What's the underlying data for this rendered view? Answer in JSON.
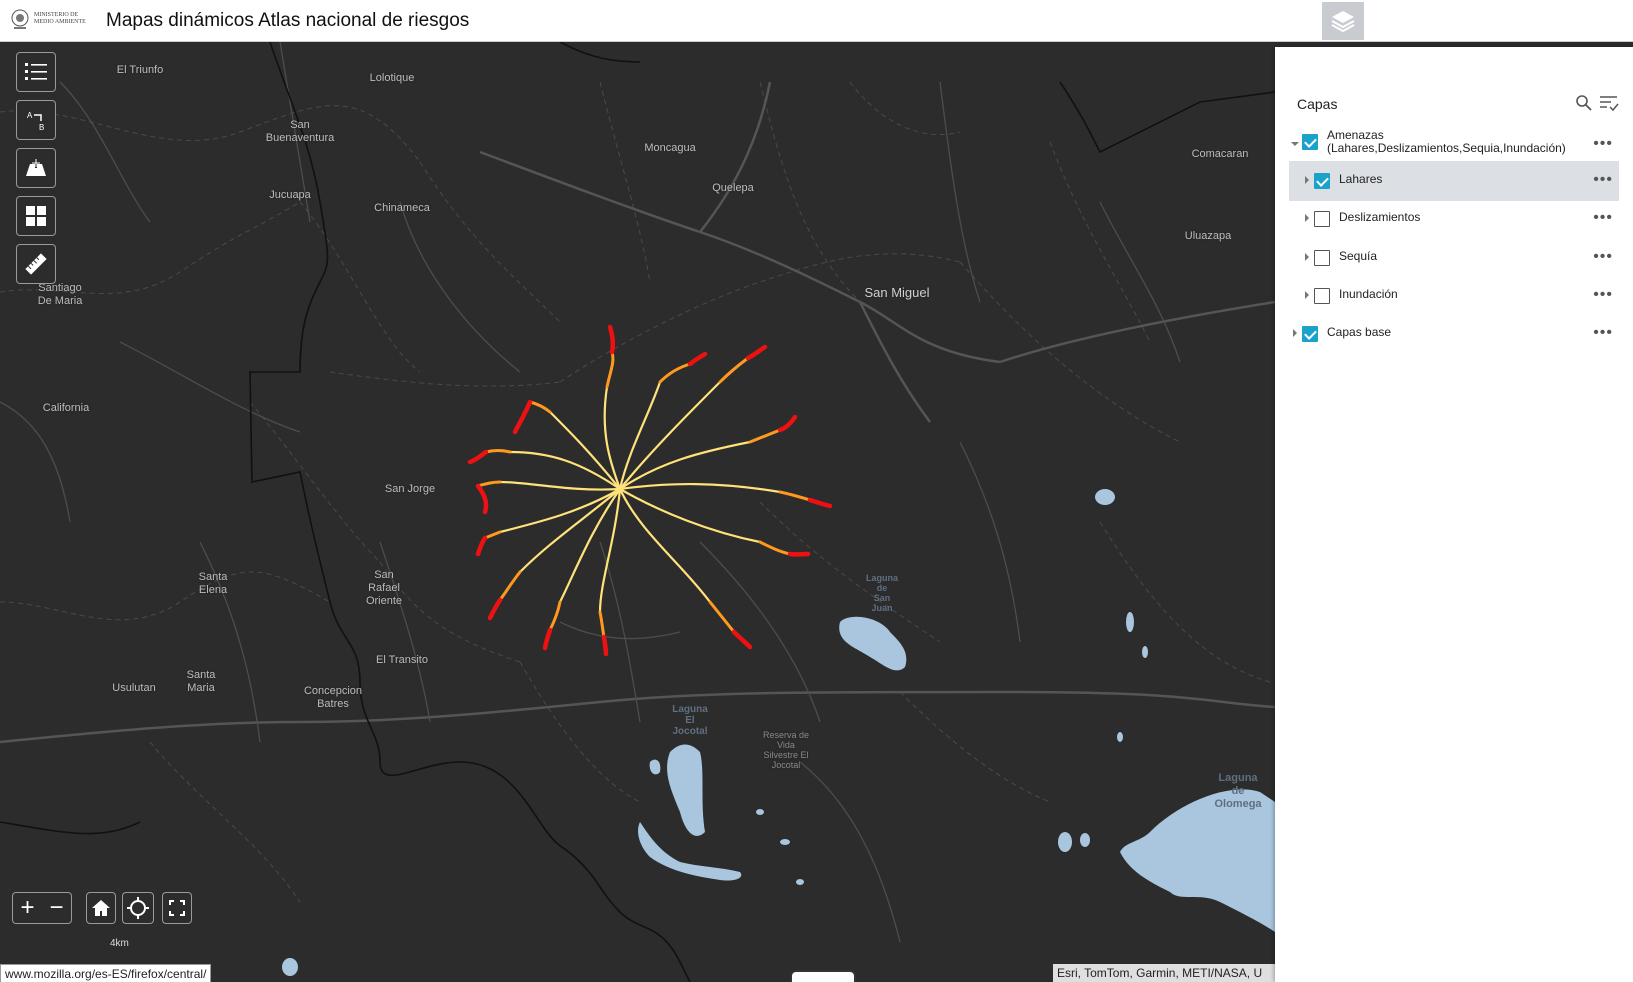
{
  "header": {
    "logo_text": "MINISTERIO DE\nMEDIO AMBIENTE",
    "title": "Mapas dinámicos Atlas nacional de riesgos",
    "layers_button_icon": "layers-icon"
  },
  "map": {
    "places": [
      {
        "name": "El Triunfo"
      },
      {
        "name": "Lolotique"
      },
      {
        "name": "San\nBuenaventura"
      },
      {
        "name": "Moncagua"
      },
      {
        "name": "Quelepa"
      },
      {
        "name": "Comacaran"
      },
      {
        "name": "Jucuapa"
      },
      {
        "name": "Chinameca"
      },
      {
        "name": "Uluazapa"
      },
      {
        "name": "San Miguel"
      },
      {
        "name": "Santiago\nDe Maria"
      },
      {
        "name": "California"
      },
      {
        "name": "San Jorge"
      },
      {
        "name": "Santa\nElena"
      },
      {
        "name": "San\nRafael\nOriente"
      },
      {
        "name": "El Transito"
      },
      {
        "name": "Santa\nMaria"
      },
      {
        "name": "Usulutan"
      },
      {
        "name": "Concepcion\nBatres"
      },
      {
        "name": "Laguna\nde\nSan\nJuan"
      },
      {
        "name": "Laguna\nEl\nJocotal"
      },
      {
        "name": "Reserva de\nVida\nSilvestre El\nJocotal"
      },
      {
        "name": "Laguna\nde\nOlomega"
      }
    ],
    "tools": [
      {
        "icon": "legend-list-icon"
      },
      {
        "icon": "directions-a-b-icon"
      },
      {
        "icon": "add-data-icon"
      },
      {
        "icon": "basemap-gallery-icon"
      },
      {
        "icon": "measure-ruler-icon"
      }
    ],
    "zoom_in": "+",
    "zoom_out": "−",
    "home_icon": "home-icon",
    "locate_icon": "locate-icon",
    "fullscreen_icon": "fullscreen-icon",
    "scale_label": "4km",
    "attribution": "Esri, TomTom, Garmin, METI/NASA, U",
    "status_url": "www.mozilla.org/es-ES/firefox/central/"
  },
  "layer_panel": {
    "title": "Capas",
    "search_icon": "search-icon",
    "filter_icon": "filter-list-icon",
    "layers": [
      {
        "label": "Amenazas\n(Lahares,Deslizamientos,Sequia,Inundación)",
        "checked": true,
        "expanded": true,
        "level": 0
      },
      {
        "label": "Lahares",
        "checked": true,
        "expanded": false,
        "level": 1,
        "selected": true
      },
      {
        "label": "Deslizamientos",
        "checked": false,
        "expanded": false,
        "level": 1
      },
      {
        "label": "Sequía",
        "checked": false,
        "expanded": false,
        "level": 1
      },
      {
        "label": "Inundación",
        "checked": false,
        "expanded": false,
        "level": 1
      },
      {
        "label": "Capas base",
        "checked": true,
        "expanded": false,
        "level": 0
      }
    ],
    "more_options": "•••"
  },
  "colors": {
    "map_bg": "#2c2c2c",
    "water": "#a9c6de",
    "lahar_low": "#ffe27a",
    "lahar_mid": "#ff9a1f",
    "lahar_high": "#ee1111",
    "checkbox_on": "#1aa2cb"
  }
}
